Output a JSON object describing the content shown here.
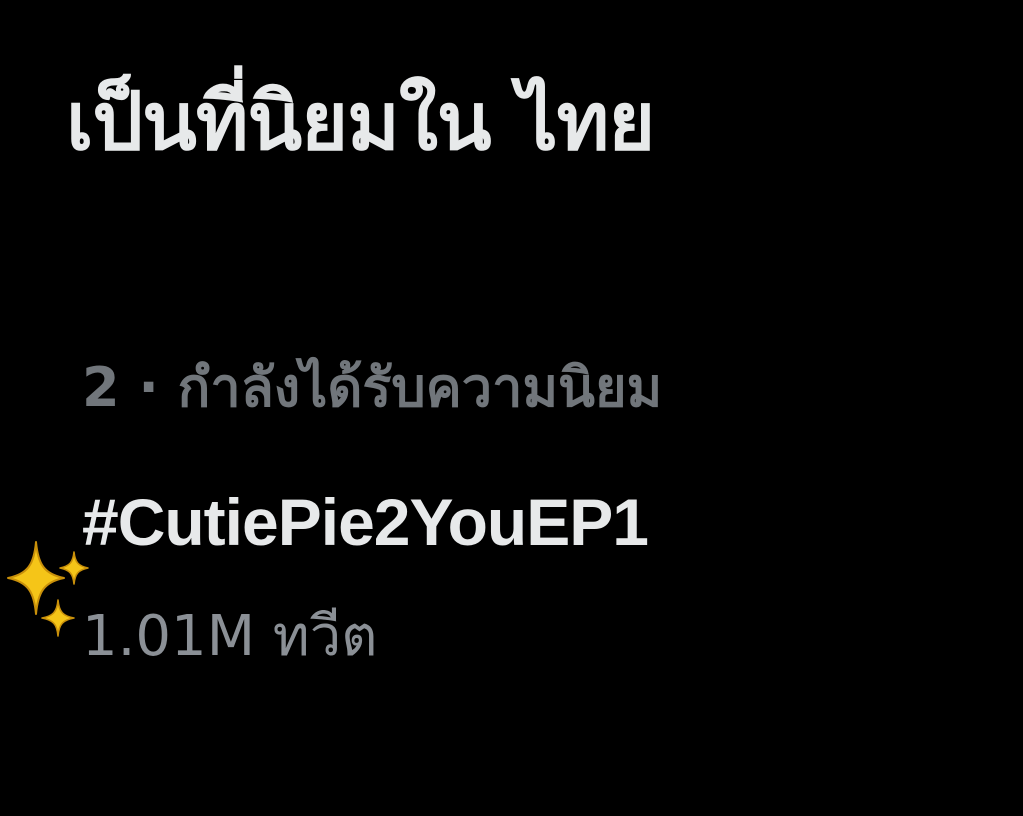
{
  "section": {
    "title": "เป็นที่นิยมใน ไทย"
  },
  "trend": {
    "meta": "2 · กำลังได้รับความนิยม",
    "hashtag": "#CutiePie2YouEP1",
    "tweet_count": "1.01M ทวีต"
  },
  "decorations": {
    "sparkles_icon": "sparkles-icon",
    "sparkle_color": "#F5C518"
  },
  "colors": {
    "background": "#000000",
    "heading": "#E7E9EA",
    "meta": "#71767B",
    "hashtag": "#E7E9EA",
    "count": "#8B9096"
  }
}
